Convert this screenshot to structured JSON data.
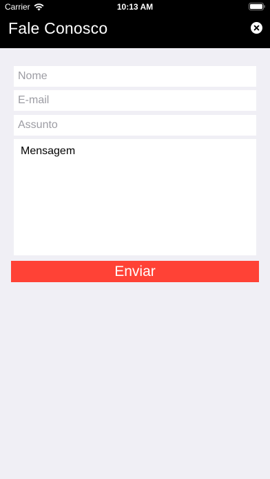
{
  "status_bar": {
    "carrier": "Carrier",
    "time": "10:13 AM",
    "wifi_icon": "wifi-icon",
    "battery_icon": "battery-icon"
  },
  "nav": {
    "title": "Fale Conosco",
    "close_icon": "close-icon"
  },
  "form": {
    "name_placeholder": "Nome",
    "email_placeholder": "E-mail",
    "subject_placeholder": "Assunto",
    "message_value": "Mensagem",
    "send_label": "Enviar"
  },
  "colors": {
    "header_bg": "#000000",
    "page_bg": "#f0eff5",
    "send_button": "#ff4236"
  }
}
